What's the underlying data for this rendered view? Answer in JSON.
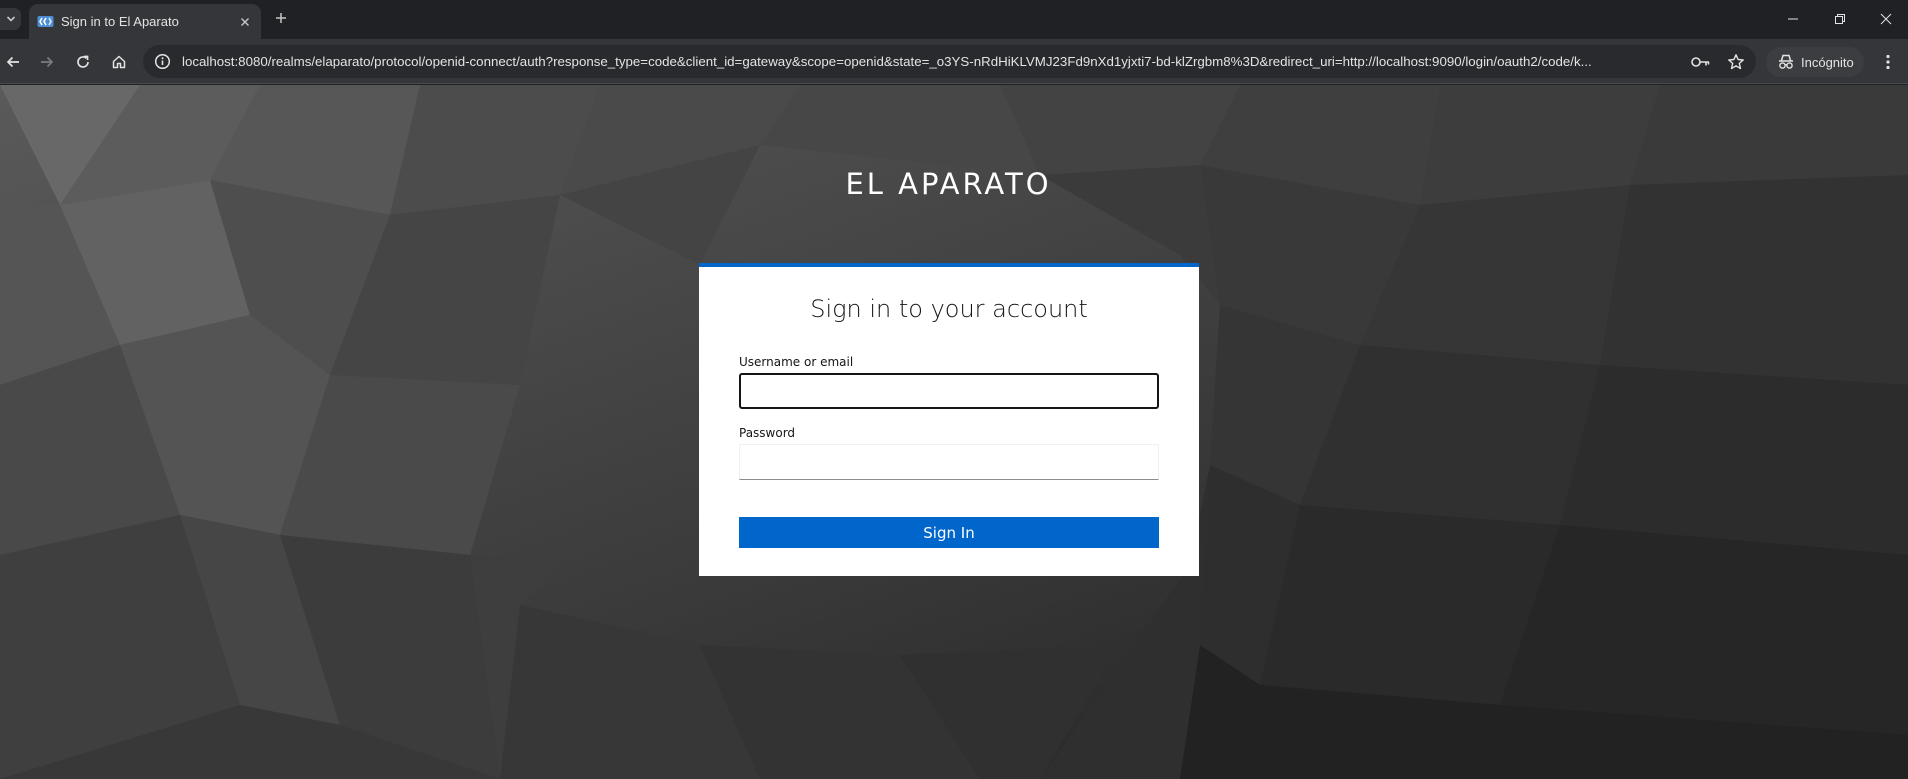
{
  "browser": {
    "tab": {
      "title": "Sign in to El Aparato",
      "favicon": "keycloak-favicon-icon"
    },
    "url": "localhost:8080/realms/elaparato/protocol/openid-connect/auth?response_type=code&client_id=gateway&scope=openid&state=_o3YS-nRdHiKLVMJ23Fd9nXd1yjxti7-bd-klZrgbm8%3D&redirect_uri=http://localhost:9090/login/oauth2/code/k...",
    "profile_label": "Incógnito",
    "colors": {
      "frame": "#202124",
      "toolbar": "#35363a",
      "omnibox": "#282a2d"
    }
  },
  "page": {
    "brand": "EL APARATO",
    "login": {
      "title": "Sign in to your account",
      "username": {
        "label": "Username or email",
        "value": ""
      },
      "password": {
        "label": "Password",
        "value": ""
      },
      "submit_label": "Sign In"
    },
    "colors": {
      "accent": "#0066cc",
      "card": "#ffffff"
    }
  }
}
